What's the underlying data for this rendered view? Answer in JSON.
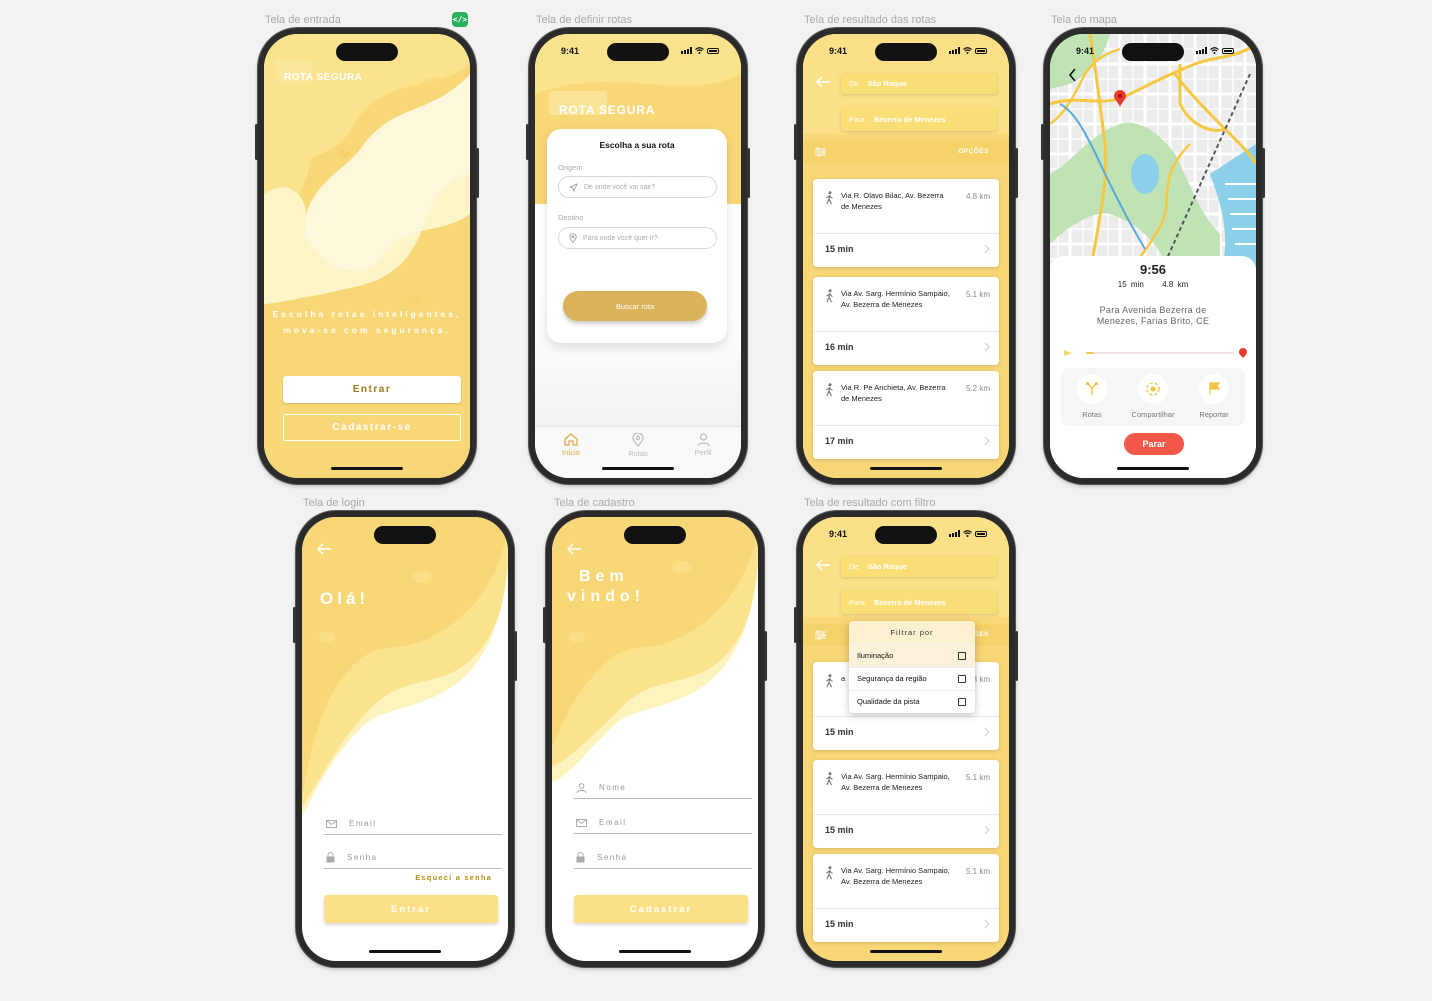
{
  "frames": {
    "welcome": "Tela de entrada",
    "define_routes": "Tela de definir rotas",
    "route_results": "Tela de resultado das rotas",
    "map": "Tela do mapa",
    "login": "Tela de login",
    "signup": "Tela de cadastro",
    "filtered_results": "Tela de resultado com filtro"
  },
  "dev_badge": "</>",
  "status_time": "9:41",
  "welcome": {
    "brand": "ROTA SEGURA",
    "slogan_line1": "Escolha rotas inteligentes,",
    "slogan_line2": "mova-se com segurança.",
    "login_button": "Entrar",
    "signup_button": "Cadastrar-se"
  },
  "define_routes": {
    "brand": "ROTA SEGURA",
    "card_title": "Escolha a sua rota",
    "origin_label": "Origem",
    "origin_placeholder": "De onde você vai sair?",
    "destination_label": "Destino",
    "destination_placeholder": "Para onde você quer ir?",
    "search_button": "Buscar rota",
    "tabs": [
      "Início",
      "Rotas",
      "Perfil"
    ]
  },
  "route_results": {
    "from_label": "De",
    "from_value": "São Roque",
    "to_label": "Para",
    "to_value": "Bezerra de Menezes",
    "options_label": "OPÇÕES",
    "routes": [
      {
        "via": "Via R. Olavo Bilac, Av. Bezerra de Menezes",
        "distance": "4.8 km",
        "duration": "15 min"
      },
      {
        "via": "Via Av. Sarg. Hermínio Sampaio, Av. Bezerra de Menezes",
        "distance": "5.1 km",
        "duration": "16 min"
      },
      {
        "via": "Via R. Pe Anchieta, Av. Bezerra de Menezes",
        "distance": "5.2 km",
        "duration": "17 min"
      }
    ]
  },
  "map": {
    "status_time": "9:41",
    "eta": "9:56",
    "duration": "15 min",
    "distance": "4.8 km",
    "destination": "Para Avenida Bezerra de Menezes, Farias Brito, CE",
    "actions": [
      "Rotas",
      "Compartilhar",
      "Reportar"
    ],
    "stop_button": "Parar",
    "progress": 0.05
  },
  "login": {
    "greeting": "Olá!",
    "email_placeholder": "Email",
    "password_placeholder": "Senha",
    "forgot": "Esqueci a senha",
    "submit": "Entrar"
  },
  "signup": {
    "greeting_line1": "Bem",
    "greeting_line2": "vindo!",
    "name_placeholder": "Nome",
    "email_placeholder": "Email",
    "password_placeholder": "Senha",
    "submit": "Cadastrar"
  },
  "filtered_results": {
    "from_label": "De",
    "from_value": "São Roque",
    "to_label": "Para",
    "to_value": "Bezerra de Menezes",
    "options_label": "OPÇÕES",
    "filter_title": "Filtrar por",
    "filters": [
      "Iluminação",
      "Segurança da região",
      "Qualidade da pista"
    ],
    "first_route_partial_via": "a",
    "first_route_partial_km": "3 km",
    "routes": [
      {
        "duration": "15 min"
      },
      {
        "via": "Via Av. Sarg. Hermínio Sampaio, Av. Bezerra de Menezes",
        "distance": "5.1 km",
        "duration": "15 min"
      },
      {
        "via": "Via Av. Sarg. Hermínio Sampaio, Av. Bezerra de Menezes",
        "distance": "5.1 km",
        "duration": "15 min"
      }
    ]
  },
  "colors": {
    "yellow": "#f8d777",
    "yellow_light": "#fbe89a",
    "cream": "#fdf8dc",
    "gold": "#d9b25a",
    "stop_red": "#f1584a"
  }
}
